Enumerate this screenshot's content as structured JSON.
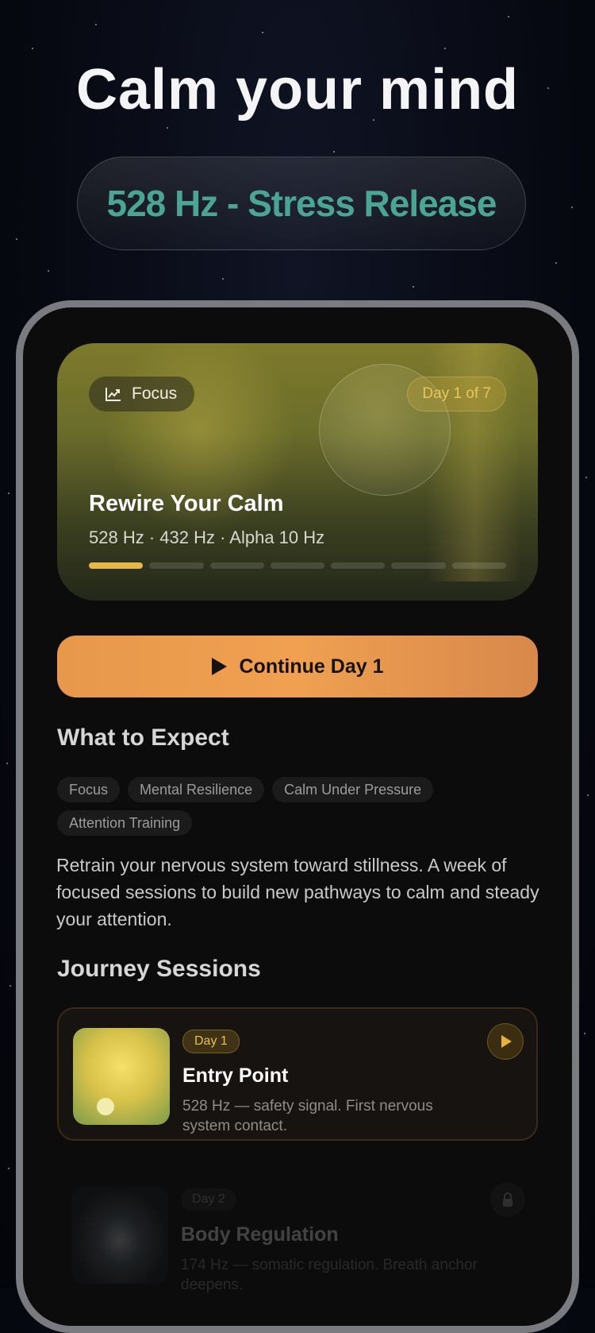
{
  "headline": "Calm your mind",
  "frequency_pill": "528 Hz - Stress Release",
  "hero": {
    "category_label": "Focus",
    "category_icon": "trending-chart-icon",
    "day_badge": "Day 1 of 7",
    "title": "Rewire Your Calm",
    "frequencies": "528 Hz · 432 Hz · Alpha 10 Hz",
    "progress_segments_total": 7,
    "progress_segments_done": 1
  },
  "cta": {
    "label": "Continue Day 1",
    "icon": "play-icon"
  },
  "expect": {
    "title": "What to Expect",
    "tags": [
      "Focus",
      "Mental Resilience",
      "Calm Under Pressure",
      "Attention Training"
    ],
    "description": "Retrain your nervous system toward stillness. A week of focused sessions to build new pathways to calm and steady your attention."
  },
  "sessions": {
    "title": "Journey Sessions",
    "items": [
      {
        "day": "Day 1",
        "title": "Entry Point",
        "subtitle": "528 Hz — safety signal. First nervous system contact.",
        "state": "unlocked",
        "icon": "play-icon"
      },
      {
        "day": "Day 2",
        "title": "Body Regulation",
        "subtitle": "174 Hz — somatic regulation. Breath anchor deepens.",
        "state": "locked",
        "icon": "lock-icon"
      }
    ]
  },
  "colors": {
    "accent_teal": "#4aa595",
    "accent_gold": "#e3b849",
    "cta_orange": "#ee9c4c",
    "background": "#070912"
  }
}
